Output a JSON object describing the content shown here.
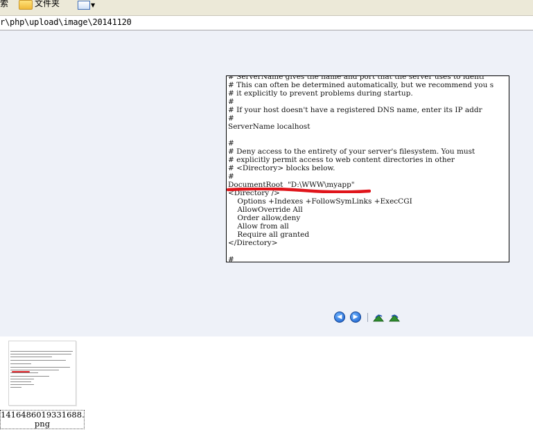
{
  "toolbar": {
    "search_label": "搜索",
    "folders_label": "文件夹",
    "views_icon": "views-icon"
  },
  "address": {
    "path": "r\\php\\upload\\image\\20141120"
  },
  "preview": {
    "image_lines": [
      "# ServerName gives the name and port that the server uses to identi",
      "# This can often be determined automatically, but we recommend you s",
      "# it explicitly to prevent problems during startup.",
      "#",
      "# If your host doesn't have a registered DNS name, enter its IP addr",
      "#",
      "ServerName localhost",
      "",
      "#",
      "# Deny access to the entirety of your server's filesystem. You must",
      "# explicitly permit access to web content directories in other",
      "# <Directory> blocks below.",
      "#",
      "DocumentRoot  \"D:\\WWW\\myapp\"",
      "<Directory />",
      "    Options +Indexes +FollowSymLinks +ExecCGI",
      "    AllowOverride All",
      "    Order allow,deny",
      "    Allow from all",
      "    Require all granted",
      "</Directory>",
      "",
      "#"
    ],
    "highlight_color": "#e0151b",
    "nav": {
      "prev_icon": "previous-image-icon",
      "next_icon": "next-image-icon",
      "rotate_cw_icon": "rotate-clockwise-icon",
      "rotate_ccw_icon": "rotate-counterclockwise-icon"
    }
  },
  "filmstrip": {
    "thumbnail_label": "1416486019331688.\npng"
  }
}
